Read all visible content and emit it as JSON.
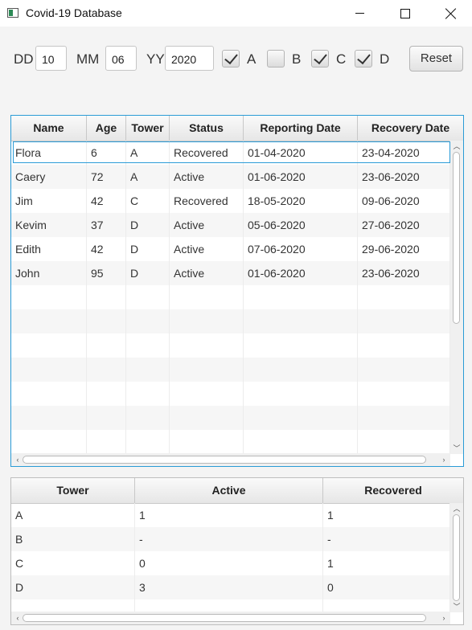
{
  "window": {
    "title": "Covid-19 Database"
  },
  "filters": {
    "dd_label": "DD",
    "dd_value": "10",
    "mm_label": "MM",
    "mm_value": "06",
    "yy_label": "YY",
    "yy_value": "2020",
    "checkboxes": [
      {
        "label": "A",
        "checked": true
      },
      {
        "label": "B",
        "checked": false
      },
      {
        "label": "C",
        "checked": true
      },
      {
        "label": "D",
        "checked": true
      }
    ],
    "reset_label": "Reset"
  },
  "patients_table": {
    "headers": [
      "Name",
      "Age",
      "Tower",
      "Status",
      "Reporting Date",
      "Recovery Date"
    ],
    "rows": [
      [
        "Flora",
        "6",
        "A",
        "Recovered",
        "01-04-2020",
        "23-04-2020"
      ],
      [
        "Caery",
        "72",
        "A",
        "Active",
        "01-06-2020",
        "23-06-2020"
      ],
      [
        "Jim",
        "42",
        "C",
        "Recovered",
        "18-05-2020",
        "09-06-2020"
      ],
      [
        "Kevim",
        "37",
        "D",
        "Active",
        "05-06-2020",
        "27-06-2020"
      ],
      [
        "Edith",
        "42",
        "D",
        "Active",
        "07-06-2020",
        "29-06-2020"
      ],
      [
        "John",
        "95",
        "D",
        "Active",
        "01-06-2020",
        "23-06-2020"
      ]
    ],
    "empty_rows": 7,
    "selected_row": 0
  },
  "summary_table": {
    "headers": [
      "Tower",
      "Active",
      "Recovered"
    ],
    "rows": [
      [
        "A",
        "1",
        "1"
      ],
      [
        "B",
        "-",
        "-"
      ],
      [
        "C",
        "0",
        "1"
      ],
      [
        "D",
        "3",
        "0"
      ]
    ]
  },
  "colors": {
    "focus": "#2a9bd6"
  }
}
